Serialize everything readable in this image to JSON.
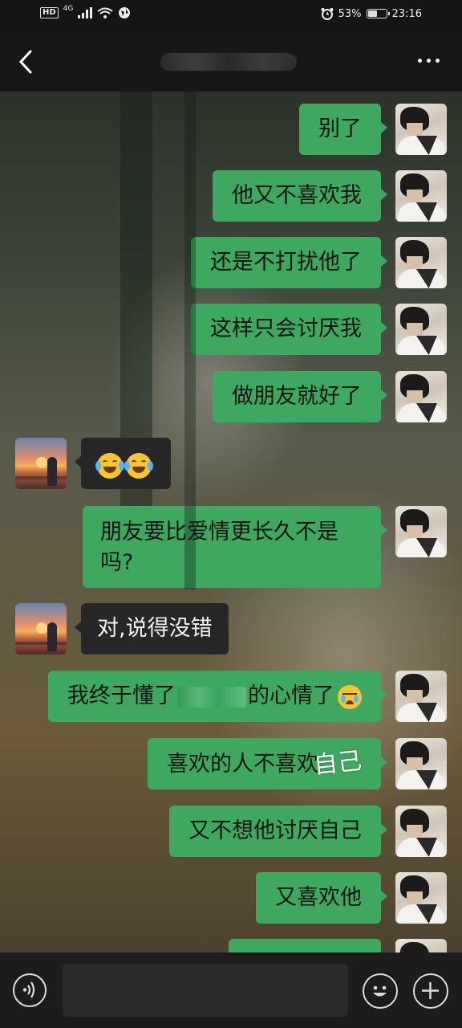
{
  "status_bar": {
    "network_hd": "HD",
    "network_gen": "4G",
    "battery_text": "53%",
    "battery_level": 0.53,
    "time": "23:16"
  },
  "header": {
    "back_icon": "chevron-left-icon",
    "title": "",
    "more_icon": "more-dots-icon"
  },
  "messages": [
    {
      "side": "out",
      "text": "别了"
    },
    {
      "side": "out",
      "text": "他又不喜欢我"
    },
    {
      "side": "out",
      "text": "还是不打扰他了"
    },
    {
      "side": "out",
      "text": "这样只会讨厌我"
    },
    {
      "side": "out",
      "text": "做朋友就好了"
    },
    {
      "side": "in",
      "text": "",
      "emoji": "face-with-tears-of-joy x2"
    },
    {
      "side": "out",
      "text": "朋友要比爱情更长久不是吗?"
    },
    {
      "side": "in",
      "text": "对,说得没错"
    },
    {
      "side": "out",
      "text_before": "我终于懂了",
      "text_after": "的心情了",
      "emoji": "crying-face"
    },
    {
      "side": "out",
      "text": "喜欢的人不喜欢",
      "overlay": "自己"
    },
    {
      "side": "out",
      "text": "又不想他讨厌自己"
    },
    {
      "side": "out",
      "text": "又喜欢他"
    }
  ],
  "input_bar": {
    "voice_icon": "voice-icon",
    "placeholder": "",
    "emoji_icon": "emoji-icon",
    "plus_icon": "plus-icon"
  }
}
